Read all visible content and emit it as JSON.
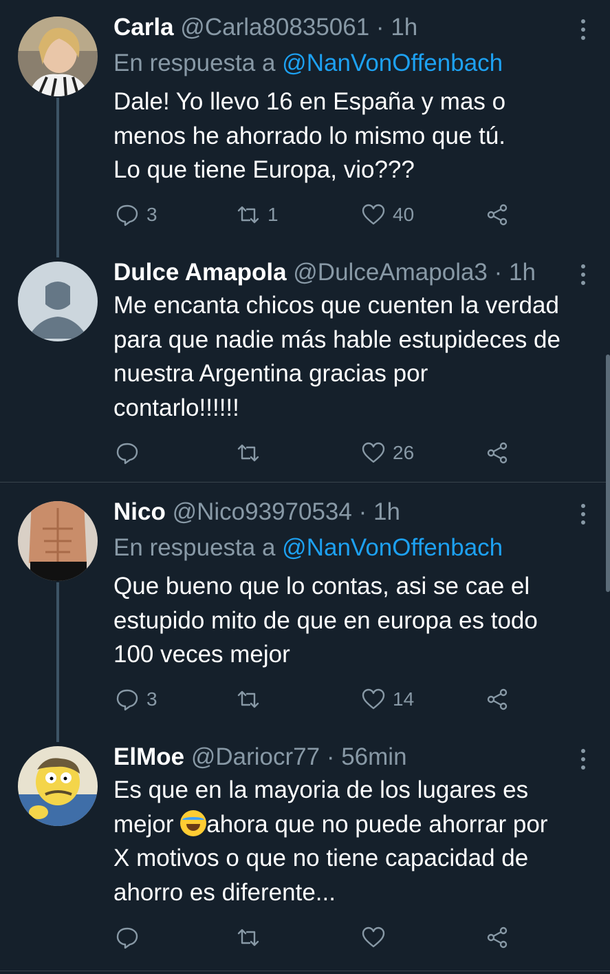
{
  "colors": {
    "background": "#15202b",
    "text": "#ffffff",
    "secondary": "#8899a6",
    "link": "#1da1f2",
    "thread_line": "#3d5466",
    "divider": "#38444d"
  },
  "tweets": [
    {
      "name": "Carla",
      "handle": "@Carla80835061",
      "separator": "·",
      "time": "1h",
      "reply_prefix": "En respuesta a",
      "reply_to": "@NanVonOffenbach",
      "text_lines": [
        "Dale! Yo llevo 16 en España y mas o",
        "menos he ahorrado lo mismo que tú.",
        "Lo que tiene Europa, vio???"
      ],
      "replies": "3",
      "retweets": "1",
      "likes": "40"
    },
    {
      "name": "Dulce Amapola",
      "handle": "@DulceAmapola3",
      "separator": "·",
      "time": "1h",
      "text_lines": [
        "Me encanta chicos que cuenten la verdad",
        "para que nadie más hable estupideces de",
        "nuestra Argentina gracias por",
        "contarlo!!!!!!"
      ],
      "replies": "",
      "retweets": "",
      "likes": "26"
    },
    {
      "name": "Nico",
      "handle": "@Nico93970534",
      "separator": "·",
      "time": "1h",
      "reply_prefix": "En respuesta a",
      "reply_to": "@NanVonOffenbach",
      "text_lines": [
        "Que bueno que lo contas, asi se cae el",
        "estupido mito de que en europa es todo",
        "100 veces mejor"
      ],
      "replies": "3",
      "retweets": "",
      "likes": "14"
    },
    {
      "name": "ElMoe",
      "handle": "@Dariocr77",
      "separator": "·",
      "time": "56min",
      "text_lines": [
        "Es que en la mayoria de los lugares es",
        "ahora que no puede ahorrar por",
        "X motivos o que no tiene capacidad de",
        "ahorro es diferente..."
      ],
      "text_line2_prefix": "mejor ",
      "emoji": "face-with-tears-of-joy",
      "replies": "",
      "retweets": "",
      "likes": ""
    }
  ],
  "icons": {
    "reply": "reply-icon",
    "retweet": "retweet-icon",
    "like": "heart-icon",
    "share": "share-icon",
    "more": "more-vertical-icon"
  }
}
